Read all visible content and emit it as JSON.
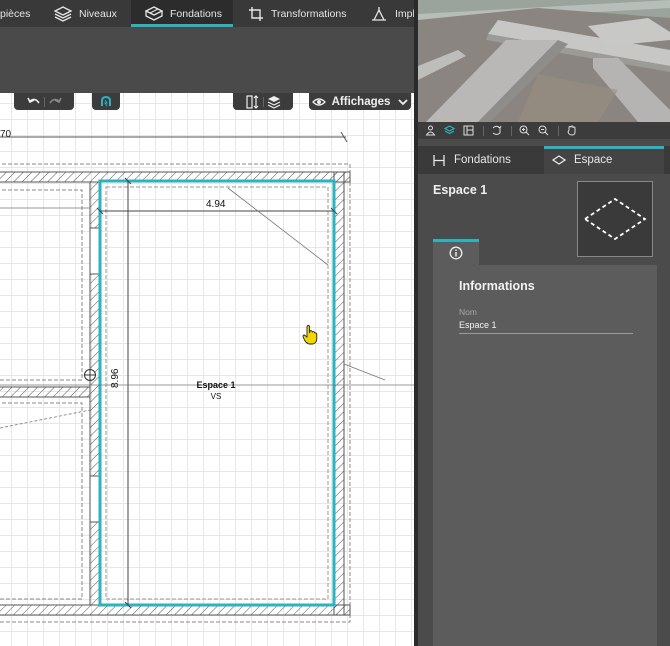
{
  "top_tabs": [
    {
      "label": "pièces",
      "icon": "rooms-icon"
    },
    {
      "label": "Niveaux",
      "icon": "levels-icon"
    },
    {
      "label": "Fondations",
      "icon": "foundations-icon",
      "active": true
    },
    {
      "label": "Transformations",
      "icon": "transform-icon"
    },
    {
      "label": "Impla",
      "icon": "implantation-icon"
    }
  ],
  "toolbar": {
    "undo_icon": "undo-icon",
    "redo_icon": "redo-icon",
    "magnet_icon": "magnet-icon",
    "displays_label": "Affichages"
  },
  "plan": {
    "top_dimension_partial": "70",
    "width_dimension": "4.94",
    "height_dimension": "8.96",
    "space_name": "Espace 1",
    "space_sub": "VS"
  },
  "panel": {
    "tabs": [
      {
        "label": "Fondations",
        "icon": "foundation-icon"
      },
      {
        "label": "Espace",
        "icon": "space-icon",
        "active": true
      }
    ],
    "object_title": "Espace 1",
    "info_title": "Informations",
    "field_label": "Nom",
    "field_value": "Espace 1"
  },
  "colors": {
    "accent": "#2bb3c0",
    "cursor": "#f2d600"
  }
}
